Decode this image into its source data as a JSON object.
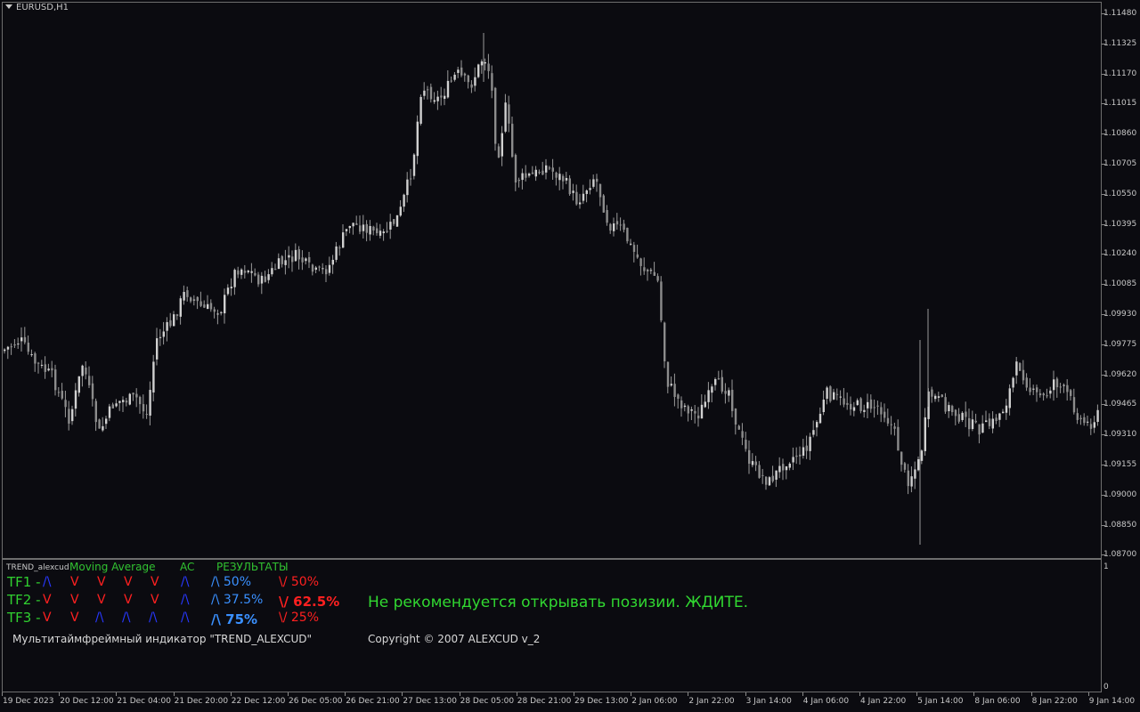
{
  "chart": {
    "symbol": "EURUSD,H1",
    "price_axis": [
      "1.11480",
      "1.11325",
      "1.11170",
      "1.11015",
      "1.10860",
      "1.10705",
      "1.10550",
      "1.10395",
      "1.10240",
      "1.10085",
      "1.09930",
      "1.09775",
      "1.09620",
      "1.09465",
      "1.09310",
      "1.09155",
      "1.09000",
      "1.08850",
      "1.08700"
    ],
    "time_axis": [
      "19 Dec 2023",
      "20 Dec 12:00",
      "21 Dec 04:00",
      "21 Dec 20:00",
      "22 Dec 12:00",
      "26 Dec 05:00",
      "26 Dec 21:00",
      "27 Dec 13:00",
      "28 Dec 05:00",
      "28 Dec 21:00",
      "29 Dec 13:00",
      "2 Jan 06:00",
      "2 Jan 22:00",
      "3 Jan 14:00",
      "4 Jan 06:00",
      "4 Jan 22:00",
      "5 Jan 14:00",
      "8 Jan 06:00",
      "8 Jan 22:00",
      "9 Jan 14:00"
    ],
    "indicator_axis": {
      "top": "1",
      "bottom": "0"
    }
  },
  "indicator": {
    "name": "TREND_alexcud",
    "headers": {
      "ma": "Moving Average",
      "ac": "AC",
      "results": "РЕЗУЛЬТАТЫ"
    },
    "rows": [
      {
        "tf": "TF1 -",
        "trend": "/\\",
        "ma": [
          "V",
          "V",
          "V",
          "V"
        ],
        "ac": "/\\",
        "up": "/\\ 50%",
        "down": "\\/ 50%"
      },
      {
        "tf": "TF2 -",
        "trend": "V",
        "ma": [
          "V",
          "V",
          "V",
          "V"
        ],
        "ac": "/\\",
        "up": "/\\ 37.5%",
        "down": "\\/ 62.5%"
      },
      {
        "tf": "TF3 -",
        "trend": "V",
        "ma": [
          "V",
          "/\\",
          "/\\",
          "/\\"
        ],
        "ac": "/\\",
        "up": "/\\ 75%",
        "down": "\\/ 25%"
      }
    ],
    "recommendation": "Не рекомендуется открывать позизии. ЖДИТЕ.",
    "description": "Мультитаймфреймный индикатор \"TREND_ALEXCUD\"",
    "copyright": "Copyright © 2007 ALEXCUD v_2"
  },
  "colors": {
    "background": "#0b0b10",
    "candle": "#b4b4b4",
    "green_text": "#31c231",
    "red": "#ff2020",
    "blue": "#2838ff",
    "light_blue": "#3a90ff"
  }
}
